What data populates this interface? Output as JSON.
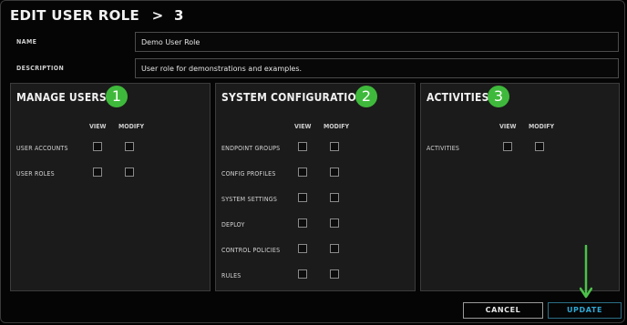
{
  "title": "EDIT USER ROLE",
  "title_separator": ">",
  "role_id": "3",
  "fields": {
    "name_label": "NAME",
    "name_value": "Demo User Role",
    "description_label": "DESCRIPTION",
    "description_value": "User role for demonstrations and examples."
  },
  "panels": [
    {
      "title": "MANAGE USERS",
      "badge": "1",
      "view_header": "VIEW",
      "modify_header": "MODIFY",
      "rows": [
        {
          "label": "USER ACCOUNTS",
          "view": false,
          "modify": false
        },
        {
          "label": "USER ROLES",
          "view": false,
          "modify": false
        }
      ]
    },
    {
      "title": "SYSTEM CONFIGURATION",
      "badge": "2",
      "view_header": "VIEW",
      "modify_header": "MODIFY",
      "rows": [
        {
          "label": "ENDPOINT GROUPS",
          "view": false,
          "modify": false
        },
        {
          "label": "CONFIG PROFILES",
          "view": false,
          "modify": false
        },
        {
          "label": "SYSTEM SETTINGS",
          "view": false,
          "modify": false
        },
        {
          "label": "DEPLOY",
          "view": false,
          "modify": false
        },
        {
          "label": "CONTROL POLICIES",
          "view": false,
          "modify": false
        },
        {
          "label": "RULES",
          "view": false,
          "modify": false
        }
      ]
    },
    {
      "title": "ACTIVITIES",
      "badge": "3",
      "view_header": "VIEW",
      "modify_header": "MODIFY",
      "rows": [
        {
          "label": "ACTIVITIES",
          "view": false,
          "modify": false
        }
      ]
    }
  ],
  "buttons": {
    "cancel": "CANCEL",
    "update": "UPDATE"
  },
  "colors": {
    "badge": "#3fb93b",
    "arrow": "#4cc14a",
    "update_text": "#2fa8d4",
    "update_border": "#2c6f86",
    "panel_bg": "#1b1b1b"
  },
  "annotation_icon": "down-arrow-icon"
}
